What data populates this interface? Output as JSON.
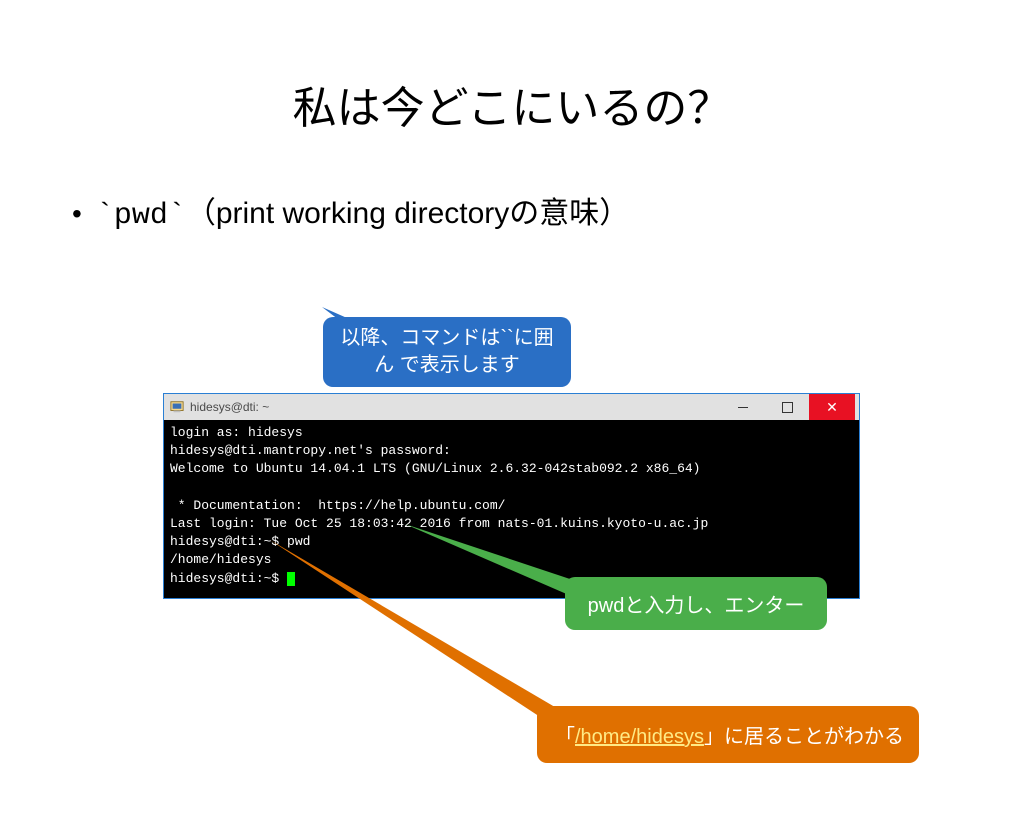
{
  "title": "私は今どこにいるの？",
  "bullet": {
    "dot": "•",
    "prefix": "`pwd`",
    "rest": "（print working directoryの意味）"
  },
  "callouts": {
    "top": "以降、コマンドは``に囲ん\nで表示します",
    "right": "pwdと入力し、エンター",
    "bottom_pre": "「",
    "bottom_link": "/home/hidesys",
    "bottom_post": "」に居ることがわかる"
  },
  "window": {
    "title": "hidesys@dti: ~"
  },
  "terminal": {
    "l1": "login as: hidesys",
    "l2": "hidesys@dti.mantropy.net's password:",
    "l3": "Welcome to Ubuntu 14.04.1 LTS (GNU/Linux 2.6.32-042stab092.2 x86_64)",
    "l4": "",
    "l5": " * Documentation:  https://help.ubuntu.com/",
    "l6": "Last login: Tue Oct 25 18:03:42 2016 from nats-01.kuins.kyoto-u.ac.jp",
    "l7": "hidesys@dti:~$ pwd",
    "l8": "/home/hidesys",
    "l9": "hidesys@dti:~$ "
  }
}
